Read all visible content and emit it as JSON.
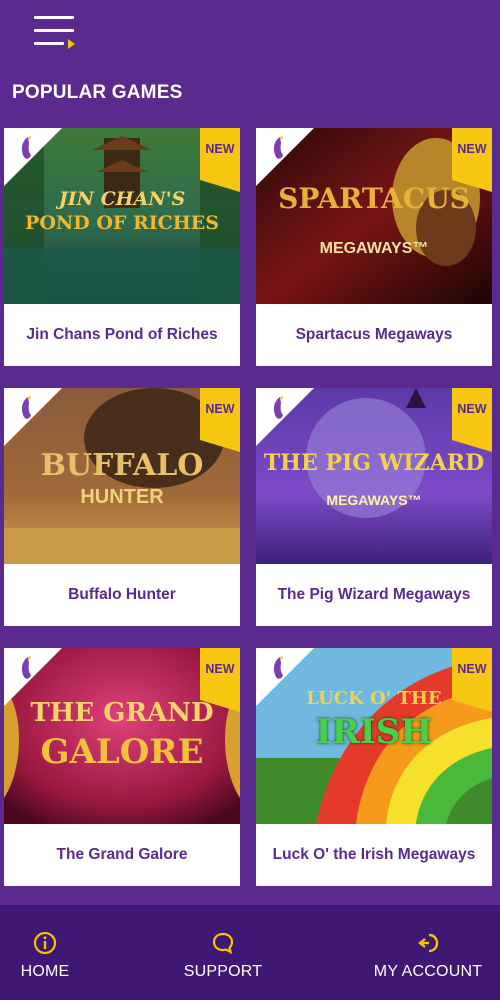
{
  "header": {
    "menu_icon": "hamburger-menu-icon",
    "section_title": "POPULAR GAMES"
  },
  "games": [
    {
      "name": "Jin Chans Pond of Riches",
      "badge": "NEW",
      "art_title_1": "JIN CHAN'S",
      "art_title_2": "POND OF RICHES"
    },
    {
      "name": "Spartacus Megaways",
      "badge": "NEW",
      "art_title_1": "SPARTACUS",
      "art_title_2": "MEGAWAYS™"
    },
    {
      "name": "Buffalo Hunter",
      "badge": "NEW",
      "art_title_1": "BUFFALO",
      "art_title_2": "HUNTER"
    },
    {
      "name": "The Pig Wizard Megaways",
      "badge": "NEW",
      "art_title_1": "THE PIG WIZARD",
      "art_title_2": "MEGAWAYS™"
    },
    {
      "name": "The Grand Galore",
      "badge": "NEW",
      "art_title_1": "THE GRAND",
      "art_title_2": "GALORE"
    },
    {
      "name": "Luck O' the Irish Megaways",
      "badge": "NEW",
      "art_title_1": "LUCK O' THE",
      "art_title_2": "IRISH"
    }
  ],
  "bottom_nav": {
    "home": {
      "label": "HOME",
      "icon": "info-circle-icon"
    },
    "support": {
      "label": "SUPPORT",
      "icon": "chat-bubble-icon"
    },
    "account": {
      "label": "MY ACCOUNT",
      "icon": "login-icon"
    }
  },
  "colors": {
    "background": "#5b2a8e",
    "nav_background": "#3f1874",
    "badge": "#f6c611",
    "card_text": "#5b2a8e"
  }
}
